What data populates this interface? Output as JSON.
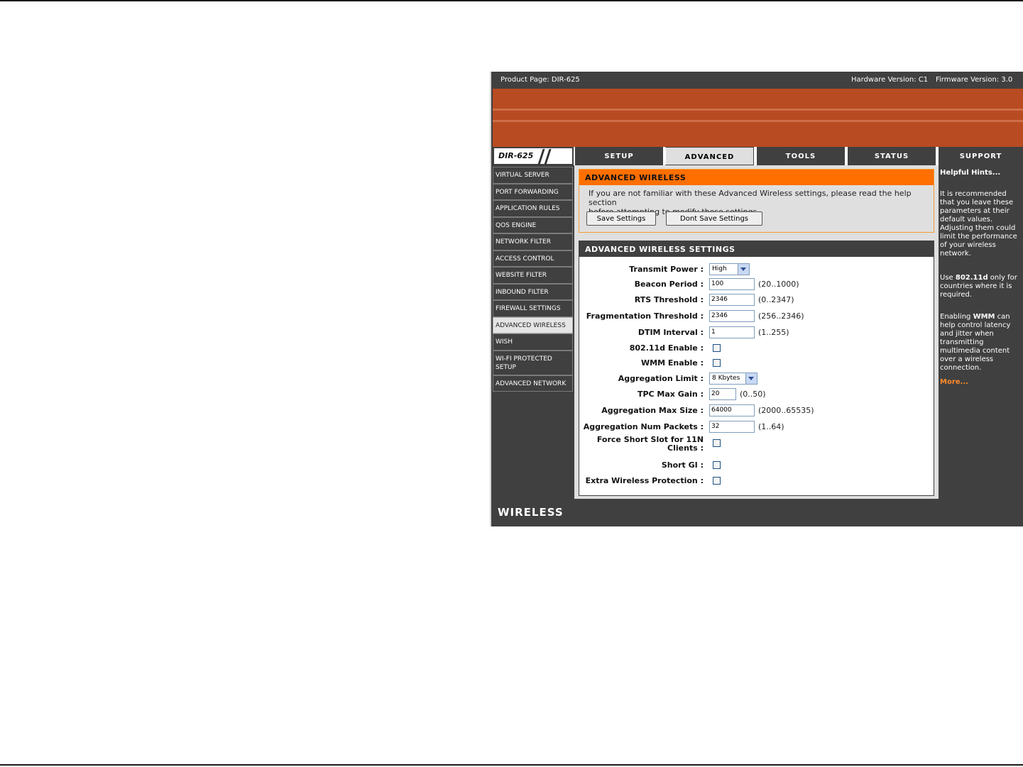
{
  "header": {
    "product": "Product Page: DIR-625",
    "hardware": "Hardware Version: C1",
    "firmware": "Firmware Version: 3.0"
  },
  "logo": "DIR-625",
  "tabs": [
    "SETUP",
    "ADVANCED",
    "TOOLS",
    "STATUS",
    "SUPPORT"
  ],
  "active_tab": "ADVANCED",
  "sidebar": {
    "items": [
      {
        "label": "VIRTUAL SERVER"
      },
      {
        "label": "PORT FORWARDING"
      },
      {
        "label": "APPLICATION RULES"
      },
      {
        "label": "QOS ENGINE"
      },
      {
        "label": "NETWORK FILTER"
      },
      {
        "label": "ACCESS CONTROL"
      },
      {
        "label": "WEBSITE FILTER"
      },
      {
        "label": "INBOUND FILTER"
      },
      {
        "label": "FIREWALL SETTINGS"
      },
      {
        "label": "ADVANCED WIRELESS"
      },
      {
        "label": "WISH"
      },
      {
        "label": "WI-FI PROTECTED SETUP"
      },
      {
        "label": "ADVANCED NETWORK"
      }
    ],
    "active": "ADVANCED WIRELESS"
  },
  "intro": {
    "title": "ADVANCED WIRELESS",
    "line1": "If you are not familiar with these Advanced Wireless settings, please read the help section",
    "line2": "before attempting to modify these settings.",
    "save_label": "Save Settings",
    "dont_save_label": "Dont Save Settings"
  },
  "settings": {
    "title": "ADVANCED WIRELESS SETTINGS",
    "transmit_power": {
      "label": "Transmit Power :",
      "value": "High"
    },
    "beacon_period": {
      "label": "Beacon Period :",
      "value": "100",
      "range": "(20..1000)"
    },
    "rts_threshold": {
      "label": "RTS Threshold :",
      "value": "2346",
      "range": "(0..2347)"
    },
    "fragmentation_threshold": {
      "label": "Fragmentation Threshold :",
      "value": "2346",
      "range": "(256..2346)"
    },
    "dtim_interval": {
      "label": "DTIM Interval :",
      "value": "1",
      "range": "(1..255)"
    },
    "dot11d_enable": {
      "label": "802.11d Enable :",
      "checked": false
    },
    "wmm_enable": {
      "label": "WMM Enable :",
      "checked": false
    },
    "aggregation_limit": {
      "label": "Aggregation Limit :",
      "value": "8 Kbytes"
    },
    "tpc_max_gain": {
      "label": "TPC Max Gain :",
      "value": "20",
      "range": "(0..50)"
    },
    "aggregation_max_size": {
      "label": "Aggregation Max Size :",
      "value": "64000",
      "range": "(2000..65535)"
    },
    "aggregation_num_packets": {
      "label": "Aggregation Num Packets :",
      "value": "32",
      "range": "(1..64)"
    },
    "force_short_slot": {
      "label": "Force Short Slot for 11N Clients :",
      "checked": false
    },
    "short_gi": {
      "label": "Short GI :",
      "checked": false
    },
    "extra_wireless_protection": {
      "label": "Extra Wireless Protection :",
      "checked": false
    }
  },
  "hints": {
    "title": "Helpful Hints...",
    "p1": "It is recommended that you leave these parameters at their default values. Adjusting them could limit the performance of your wireless network.",
    "p2_pre": "Use ",
    "p2_bold": "802.11d",
    "p2_post": " only for countries where it is required.",
    "p3_pre": "Enabling ",
    "p3_bold": "WMM",
    "p3_post": " can help control latency and jitter when transmitting multimedia content over a wireless connection.",
    "more": "More..."
  },
  "footer": "WIRELESS",
  "colors": {
    "banner": "#b84b22",
    "accent_orange": "#ff6f00",
    "dark_gray": "#404040",
    "content_bg": "#dfdfdf",
    "more_link": "#ff8a2a"
  }
}
